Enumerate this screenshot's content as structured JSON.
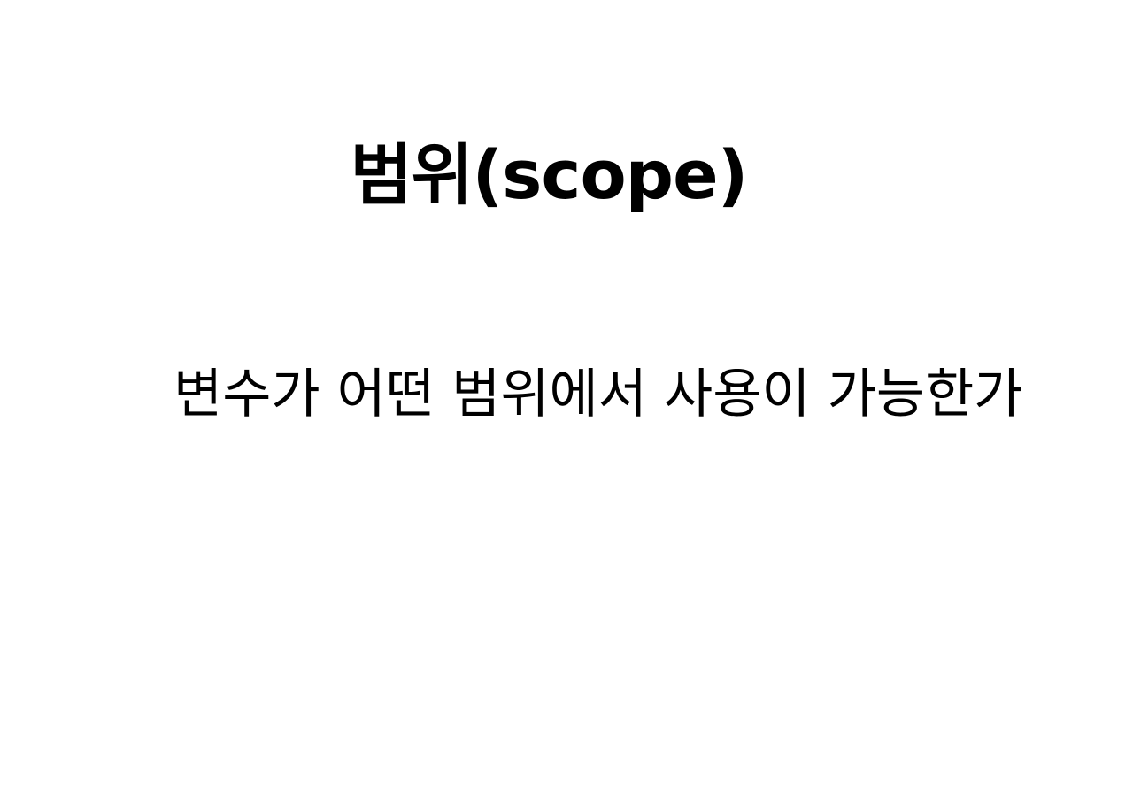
{
  "slide": {
    "title": "범위(scope)",
    "body": "변수가 어떤 범위에서 사용이 가능한가"
  }
}
